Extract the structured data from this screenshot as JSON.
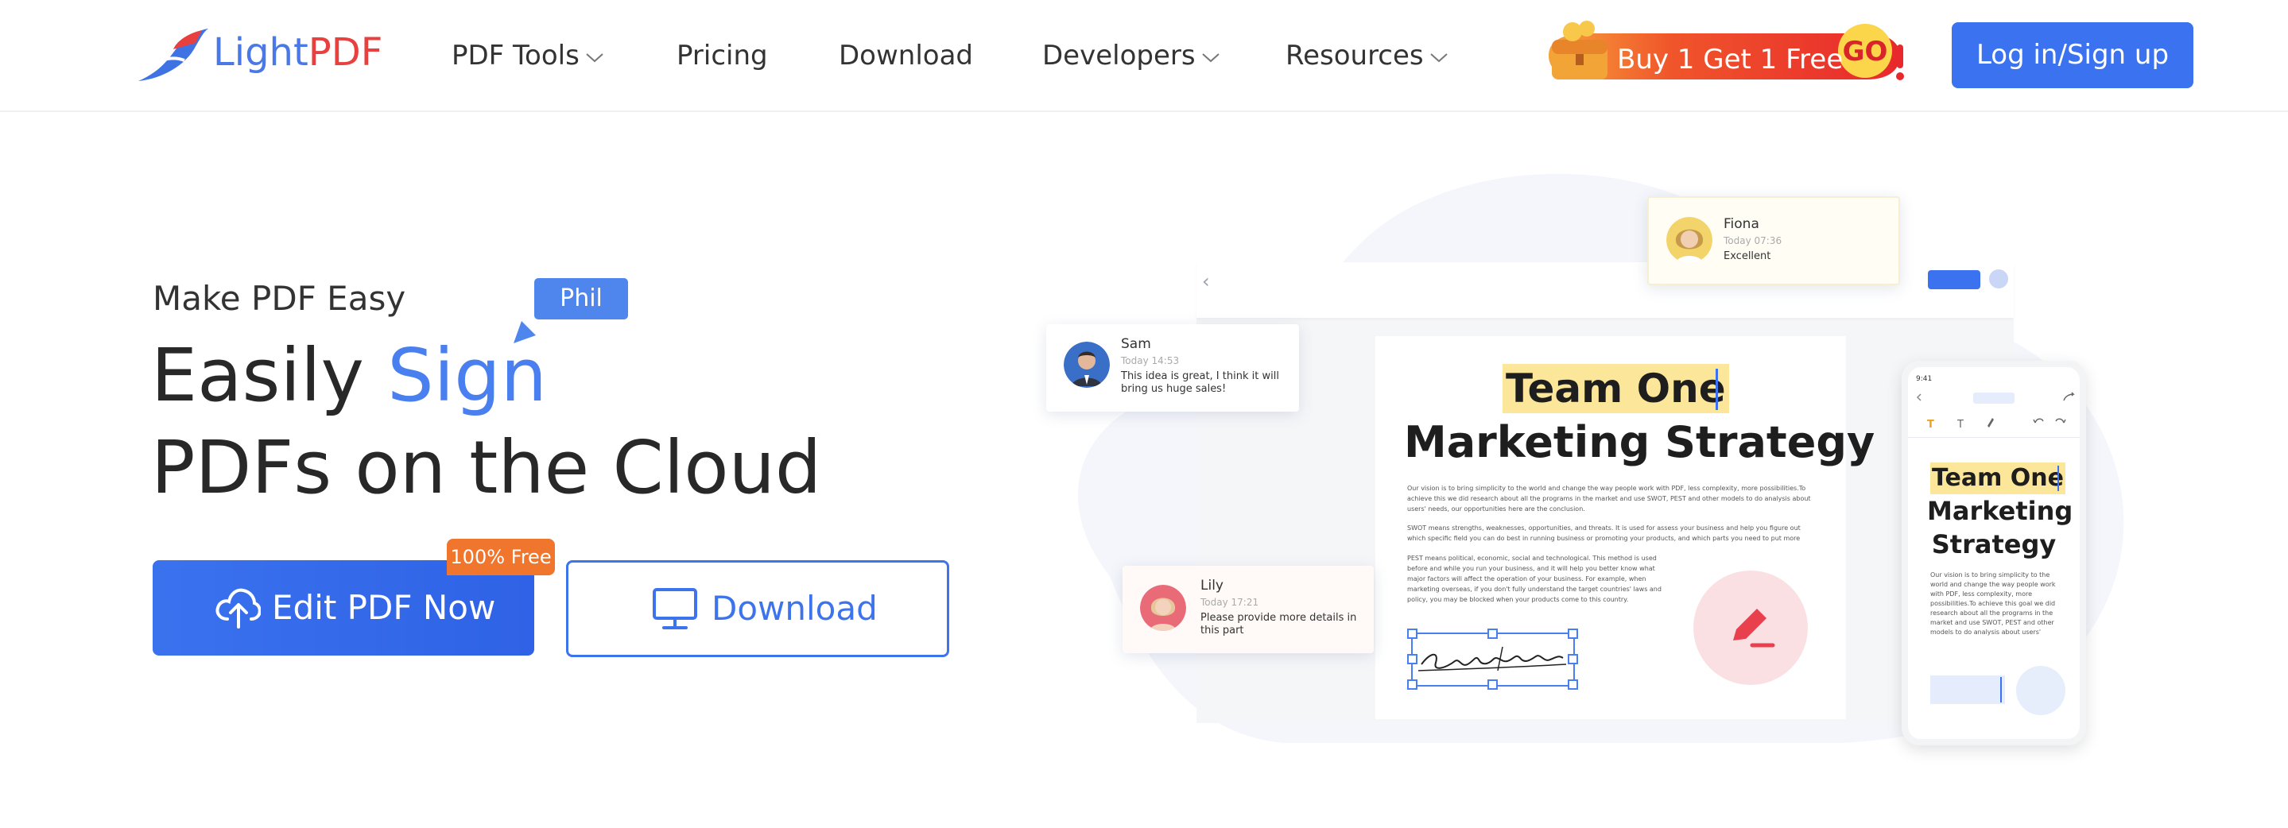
{
  "brand": {
    "name_part1": "Light",
    "name_part2": "PDF"
  },
  "nav": {
    "items": [
      {
        "label": "PDF Tools",
        "has_dropdown": true
      },
      {
        "label": "Pricing",
        "has_dropdown": false
      },
      {
        "label": "Download",
        "has_dropdown": false
      },
      {
        "label": "Developers",
        "has_dropdown": true
      },
      {
        "label": "Resources",
        "has_dropdown": true
      }
    ],
    "promo_label": "Buy 1 Get 1 Free",
    "promo_go": "GO",
    "login_label": "Log in/Sign up"
  },
  "hero": {
    "eyebrow": "Make PDF Easy",
    "cursor_tag": "Phil",
    "headline_prefix": "Easily ",
    "headline_accent": "Sign",
    "headline_line2": "PDFs on the Cloud",
    "primary_button": "Edit PDF Now",
    "free_badge": "100% Free",
    "secondary_button": "Download"
  },
  "illustration": {
    "doc_title_line1": "Team One",
    "doc_title_line2": "Marketing Strategy",
    "paragraphs": [
      "Our vision is to bring simplicity to the world and change the way people work with PDF, less complexity, more possibilities.To achieve this we did research about all the programs in the market and use SWOT, PEST and other models to do analysis about users' needs, our opportunities here are the conclusion.",
      "SWOT means strengths, weaknesses, opportunities, and threats. It is used for assess your business and help you figure out which specific field you can do best in running business or promoting your products, and which parts you need to put more attention to avoid threats.",
      "PEST means political, economic, social and technological. This method is used before and while you run your business, and it will help you better know what major factors will affect the operation of your business. For example, when marketing overseas, if you don't fully understand the target countries' laws and policy, you may be blocked when your products come to this country."
    ],
    "comments": {
      "sam": {
        "name": "Sam",
        "time": "Today 14:53",
        "message": "This idea is great, I think it will bring us huge sales!"
      },
      "fiona": {
        "name": "Fiona",
        "time": "Today 07:36",
        "message": "Excellent"
      },
      "lily": {
        "name": "Lily",
        "time": "Today 17:21",
        "message": "Please provide more details in this part"
      }
    },
    "phone": {
      "time": "9:41",
      "title_line1": "Team One",
      "title_line2": "Marketing Strategy",
      "paragraph": "Our vision is to bring simplicity to the world and change the way people work with PDF, less complexity, more possibilities.To achieve this goal we did research about all the programs in the market and use SWOT, PEST and other models to do analysis about users' needs our opportunities here are the conclusion."
    }
  },
  "colors": {
    "accent": "#3b72ef",
    "brand_red": "#e8403f",
    "badge_orange": "#f0752d",
    "highlight": "#fbe69a"
  }
}
